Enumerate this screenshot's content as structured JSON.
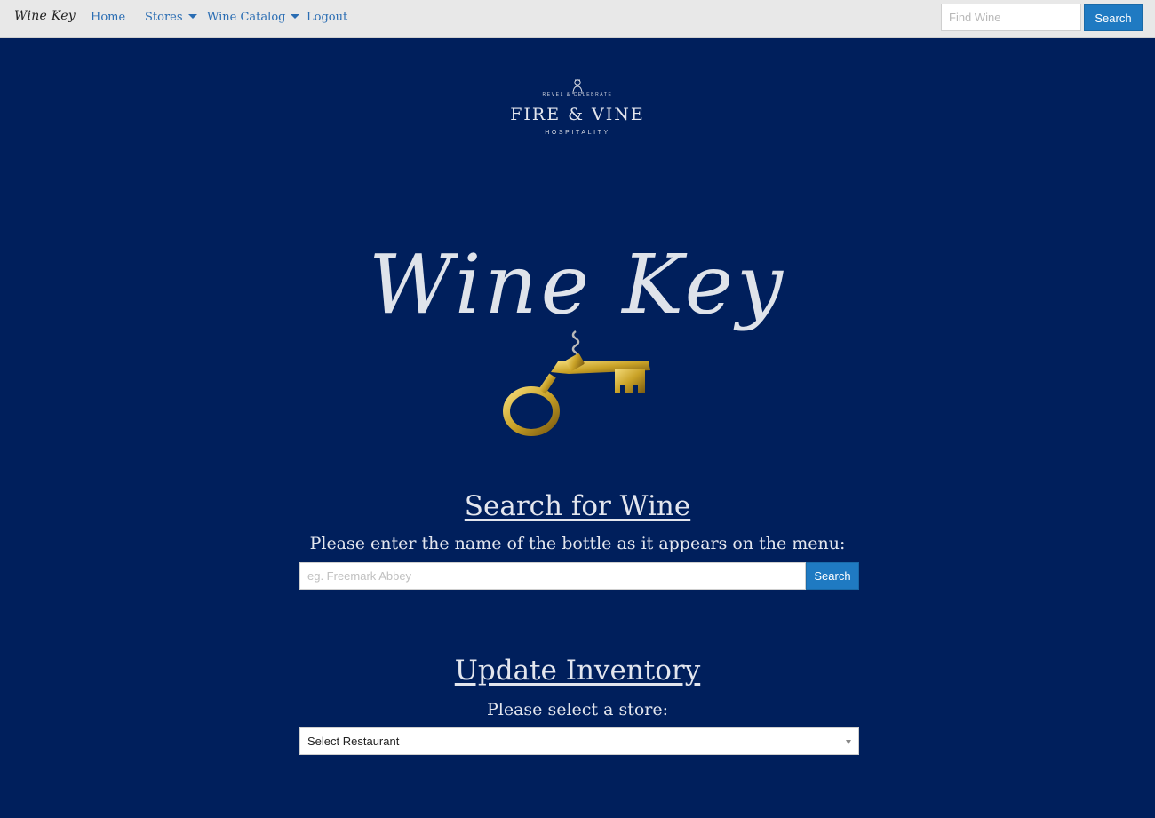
{
  "navbar": {
    "brand": "Wine Key",
    "items": [
      {
        "label": "Home",
        "has_dropdown": false
      },
      {
        "label": "Stores",
        "has_dropdown": true
      },
      {
        "label": "Wine Catalog",
        "has_dropdown": true
      },
      {
        "label": "Logout",
        "has_dropdown": false
      }
    ],
    "search": {
      "placeholder": "Find Wine",
      "button_label": "Search"
    }
  },
  "logo": {
    "tagline": "REVEL & CELEBRATE",
    "name": "FIRE & VINE",
    "subtitle": "HOSPITALITY"
  },
  "hero": {
    "title": "Wine Key",
    "image": "golden-corkscrew-key-icon"
  },
  "search_section": {
    "heading": "Search for Wine",
    "instruction": "Please enter the name of the bottle as it appears on the menu:",
    "input_placeholder": "eg. Freemark Abbey",
    "button_label": "Search"
  },
  "inventory_section": {
    "heading": "Update Inventory",
    "instruction": "Please select a store:",
    "select_value": "Select Restaurant"
  },
  "colors": {
    "background": "#001f5c",
    "navbar": "#e8e8e8",
    "link": "#2a6db3",
    "button": "#1f7ac2",
    "gold": "#c9a227"
  }
}
